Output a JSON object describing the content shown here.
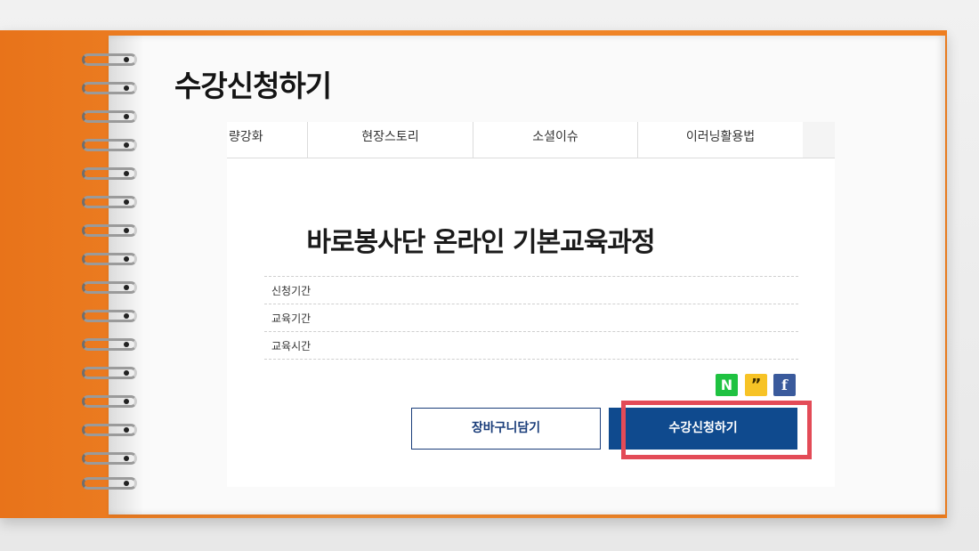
{
  "heading": "수강신청하기",
  "tabs": [
    {
      "label": "량강화"
    },
    {
      "label": "현장스토리"
    },
    {
      "label": "소셜이슈"
    },
    {
      "label": "이러닝활용법"
    }
  ],
  "course": {
    "title": "바로봉사단 온라인 기본교육과정",
    "info": [
      {
        "label": "신청기간"
      },
      {
        "label": "교육기간"
      },
      {
        "label": "교육시간"
      }
    ]
  },
  "share": {
    "naver": "N",
    "kakao": "”",
    "facebook": "f"
  },
  "buttons": {
    "cart": "장바구니담기",
    "apply": "수강신청하기"
  },
  "colors": {
    "notebook_cover": "#f18a2c",
    "apply_button": "#0f4a8e",
    "highlight": "#e34b57"
  },
  "icons": [
    "naver-share-icon",
    "kakao-share-icon",
    "facebook-share-icon"
  ]
}
